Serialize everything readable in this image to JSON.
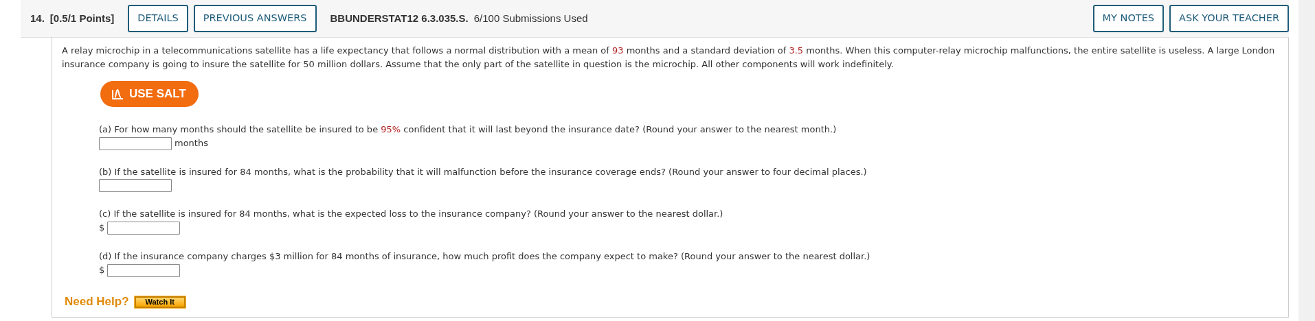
{
  "header": {
    "number": "14.",
    "points": "[0.5/1 Points]",
    "buttons_left": [
      "DETAILS",
      "PREVIOUS ANSWERS"
    ],
    "code": "BBUNDERSTAT12 6.3.035.S.",
    "submissions": "6/100 Submissions Used",
    "buttons_right": [
      "MY NOTES",
      "ASK YOUR TEACHER"
    ]
  },
  "intro": [
    {
      "text": "A relay microchip in a telecommunications satellite has a life expectancy that follows a normal distribution with a mean of ",
      "highlight": false
    },
    {
      "text": "93",
      "highlight": true
    },
    {
      "text": " months and a standard deviation of ",
      "highlight": false
    },
    {
      "text": "3.5",
      "highlight": true
    },
    {
      "text": " months. When this computer-relay microchip malfunctions, the entire satellite is useless. A large London insurance company is going to insure the satellite for 50 million dollars. Assume that the only part of the satellite in question is the microchip. All other components will work indefinitely.",
      "highlight": false
    }
  ],
  "salt_button": "USE SALT",
  "parts": [
    {
      "question": [
        {
          "text": "(a) For how many months should the satellite be insured to be ",
          "highlight": false
        },
        {
          "text": "95%",
          "highlight": true
        },
        {
          "text": " confident that it will last beyond the insurance date? (Round your answer to the nearest month.)",
          "highlight": false
        }
      ],
      "suffix": "months"
    },
    {
      "question": [
        {
          "text": "(b) If the satellite is insured for 84 months, what is the probability that it will malfunction before the insurance coverage ends? (Round your answer to four decimal places.)",
          "highlight": false
        }
      ]
    },
    {
      "question": [
        {
          "text": "(c) If the satellite is insured for 84 months, what is the expected loss to the insurance company? (Round your answer to the nearest dollar.)",
          "highlight": false
        }
      ],
      "prefix": "$"
    },
    {
      "question": [
        {
          "text": "(d) If the insurance company charges $3 million for 84 months of insurance, how much profit does the company expect to make? (Round your answer to the nearest dollar.)",
          "highlight": false
        }
      ],
      "prefix": "$"
    }
  ],
  "help": {
    "label": "Need Help?",
    "button": "Watch It"
  }
}
